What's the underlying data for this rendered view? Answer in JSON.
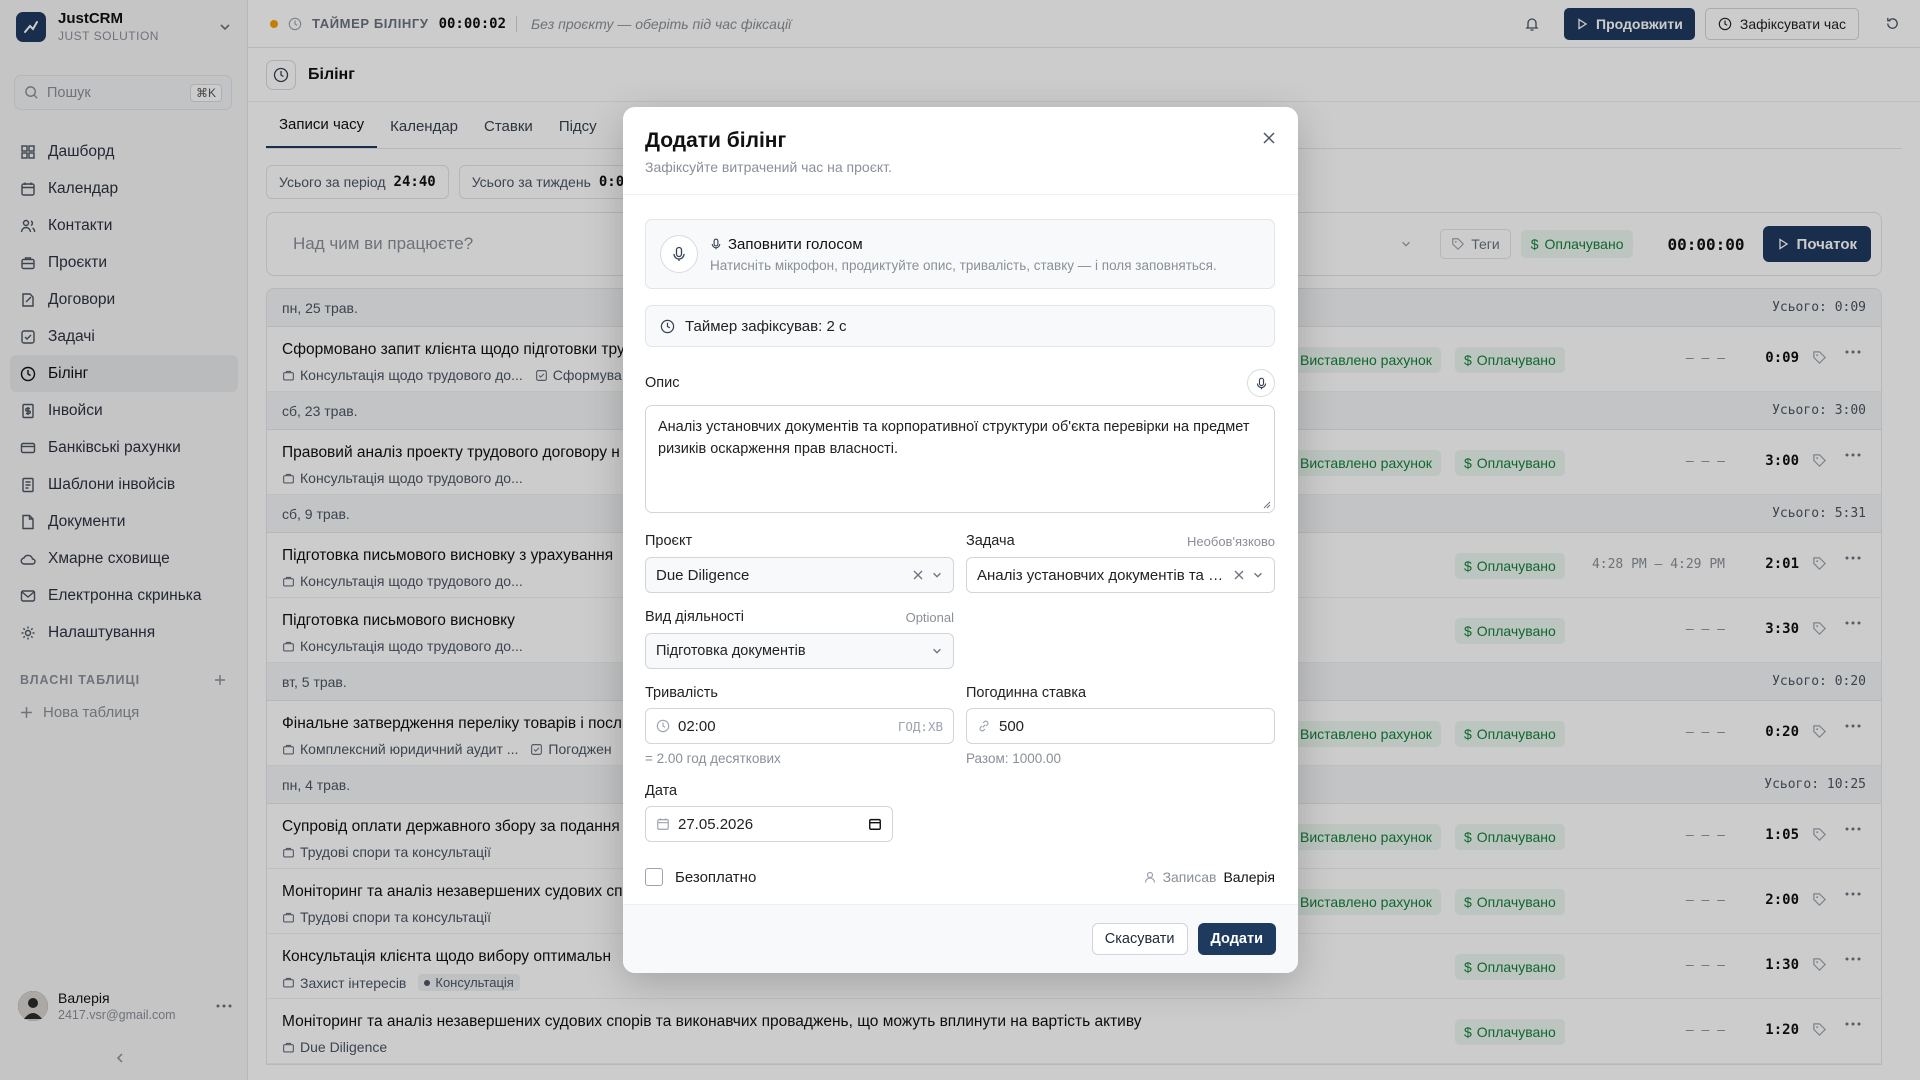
{
  "brand": {
    "name": "JustCRM",
    "sub": "JUST SOLUTION"
  },
  "search": {
    "placeholder": "Пошук",
    "shortcut": "⌘K"
  },
  "nav": [
    {
      "label": "Дашборд",
      "icon": "dashboard-icon"
    },
    {
      "label": "Календар",
      "icon": "calendar-icon"
    },
    {
      "label": "Контакти",
      "icon": "contacts-icon"
    },
    {
      "label": "Проєкти",
      "icon": "projects-icon"
    },
    {
      "label": "Договори",
      "icon": "contracts-icon"
    },
    {
      "label": "Задачі",
      "icon": "tasks-icon"
    },
    {
      "label": "Білінг",
      "icon": "billing-clock-icon",
      "active": true
    },
    {
      "label": "Інвойси",
      "icon": "invoice-icon"
    },
    {
      "label": "Банківські рахунки",
      "icon": "bank-icon"
    },
    {
      "label": "Шаблони інвойсів",
      "icon": "template-icon"
    },
    {
      "label": "Документи",
      "icon": "document-icon"
    },
    {
      "label": "Хмарне сховище",
      "icon": "cloud-icon"
    },
    {
      "label": "Електронна скринька",
      "icon": "mail-icon"
    },
    {
      "label": "Налаштування",
      "icon": "settings-icon"
    }
  ],
  "custom_tables": {
    "title": "ВЛАСНІ ТАБЛИЦІ",
    "new_label": "Нова таблиця"
  },
  "user": {
    "name": "Валерія",
    "email": "2417.vsr@gmail.com"
  },
  "topbar": {
    "timer_label": "ТАЙМЕР БІЛІНГУ",
    "timer_value": "00:00:02",
    "hint": "Без проєкту — оберіть під час фіксації",
    "continue_label": "Продовжити",
    "fix_label": "Зафіксувати час"
  },
  "page": {
    "title": "Білінг"
  },
  "tabs": [
    "Записи часу",
    "Календар",
    "Ставки",
    "Підсу"
  ],
  "stats": [
    {
      "label": "Усього за період",
      "value": "24:40"
    },
    {
      "label": "Усього за тиждень",
      "value": "0:0"
    }
  ],
  "entry_bar": {
    "placeholder": "Над чим ви працюєте?",
    "tags_label": "Теги",
    "billable_label": "Оплачувано",
    "timer": "00:00:00",
    "start_label": "Початок"
  },
  "days": [
    {
      "label": "пн, 25 трав.",
      "total": "Усього: 0:09",
      "rows": [
        {
          "title": "Сформовано запит клієнта щодо підготовки тру",
          "project": "Консультація щодо трудового до...",
          "task": "Сформува",
          "invoiced": "Виставлено рахунок",
          "billable": "Оплачувано",
          "range": "– – –",
          "duration": "0:09"
        }
      ]
    },
    {
      "label": "сб, 23 трав.",
      "total": "Усього: 3:00",
      "rows": [
        {
          "title": "Правовий аналіз проекту трудового договору н",
          "project": "Консультація щодо трудового до...",
          "invoiced": "Виставлено рахунок",
          "billable": "Оплачувано",
          "range": "– – –",
          "duration": "3:00"
        }
      ]
    },
    {
      "label": "сб, 9 трав.",
      "total": "Усього: 5:31",
      "rows": [
        {
          "title": "Підготовка письмового висновку з урахування",
          "project": "Консультація щодо трудового до...",
          "billable": "Оплачувано",
          "range": "4:28 PM – 4:29 PM",
          "duration": "2:01"
        },
        {
          "title": "Підготовка письмового висновку",
          "project": "Консультація щодо трудового до...",
          "billable": "Оплачувано",
          "range": "– – –",
          "duration": "3:30"
        }
      ]
    },
    {
      "label": "вт, 5 трав.",
      "total": "Усього: 0:20",
      "rows": [
        {
          "title": "Фінальне затвердження переліку товарів і посл",
          "project": "Комплексний юридичний аудит ...",
          "task": "Погоджен",
          "invoiced": "Виставлено рахунок",
          "billable": "Оплачувано",
          "range": "– – –",
          "duration": "0:20"
        }
      ]
    },
    {
      "label": "пн, 4 трав.",
      "total": "Усього: 10:25",
      "rows": [
        {
          "title": "Супровід оплати державного збору за подання",
          "project": "Трудові спори та консультації",
          "invoiced": "Виставлено рахунок",
          "billable": "Оплачувано",
          "range": "– – –",
          "duration": "1:05"
        },
        {
          "title": "Моніторинг та аналіз незавершених судових сп",
          "project": "Трудові спори та консультації",
          "invoiced": "Виставлено рахунок",
          "billable": "Оплачувано",
          "range": "– – –",
          "duration": "2:00"
        },
        {
          "title": "Консультація клієнта щодо вибору оптимальн",
          "project": "Захист інтересів",
          "tag": "Консультація",
          "billable": "Оплачувано",
          "range": "– – –",
          "duration": "1:30"
        },
        {
          "title": "Моніторинг та аналіз незавершених судових спорів та виконавчих проваджень, що можуть вплинути на вартість активу",
          "project": "Due Diligence",
          "billable": "Оплачувано",
          "range": "– – –",
          "duration": "1:20"
        }
      ]
    }
  ],
  "modal": {
    "title": "Додати білінг",
    "subtitle": "Зафіксуйте витрачений час на проєкт.",
    "voice_title": "Заповнити голосом",
    "voice_hint": "Натисніть мікрофон, продиктуйте опис, тривалість, ставку — і поля заповняться.",
    "captured": "Таймер зафіксував: 2  с",
    "desc_label": "Опис",
    "desc_value": "Аналіз установчих документів та корпоративної структури об'єкта перевірки на предмет ризиків оскарження прав власності.",
    "project_label": "Проєкт",
    "project_value": "Due Diligence",
    "task_label": "Задача",
    "task_optional": "Необов'язково",
    "task_value": "Аналіз установчих документів та корпоративної структури",
    "activity_label": "Вид діяльності",
    "activity_optional": "Optional",
    "activity_value": "Підготовка документів",
    "duration_label": "Тривалість",
    "duration_value": "02:00",
    "duration_unit": "ГОД:ХВ",
    "duration_hint": "= 2.00 год десяткових",
    "rate_label": "Погодинна ставка",
    "rate_value": "500",
    "rate_hint": "Разом: 1000.00",
    "date_label": "Дата",
    "date_value": "27.05.2026",
    "free_label": "Безоплатно",
    "recorded_by_label": "Записав",
    "recorded_by": "Валерія",
    "cancel_label": "Скасувати",
    "add_label": "Додати"
  },
  "colors": {
    "accent": "#1e3a5f",
    "success_bg": "#ecf7ef",
    "success_text": "#15803d",
    "timer_dot": "#f59e0b"
  }
}
